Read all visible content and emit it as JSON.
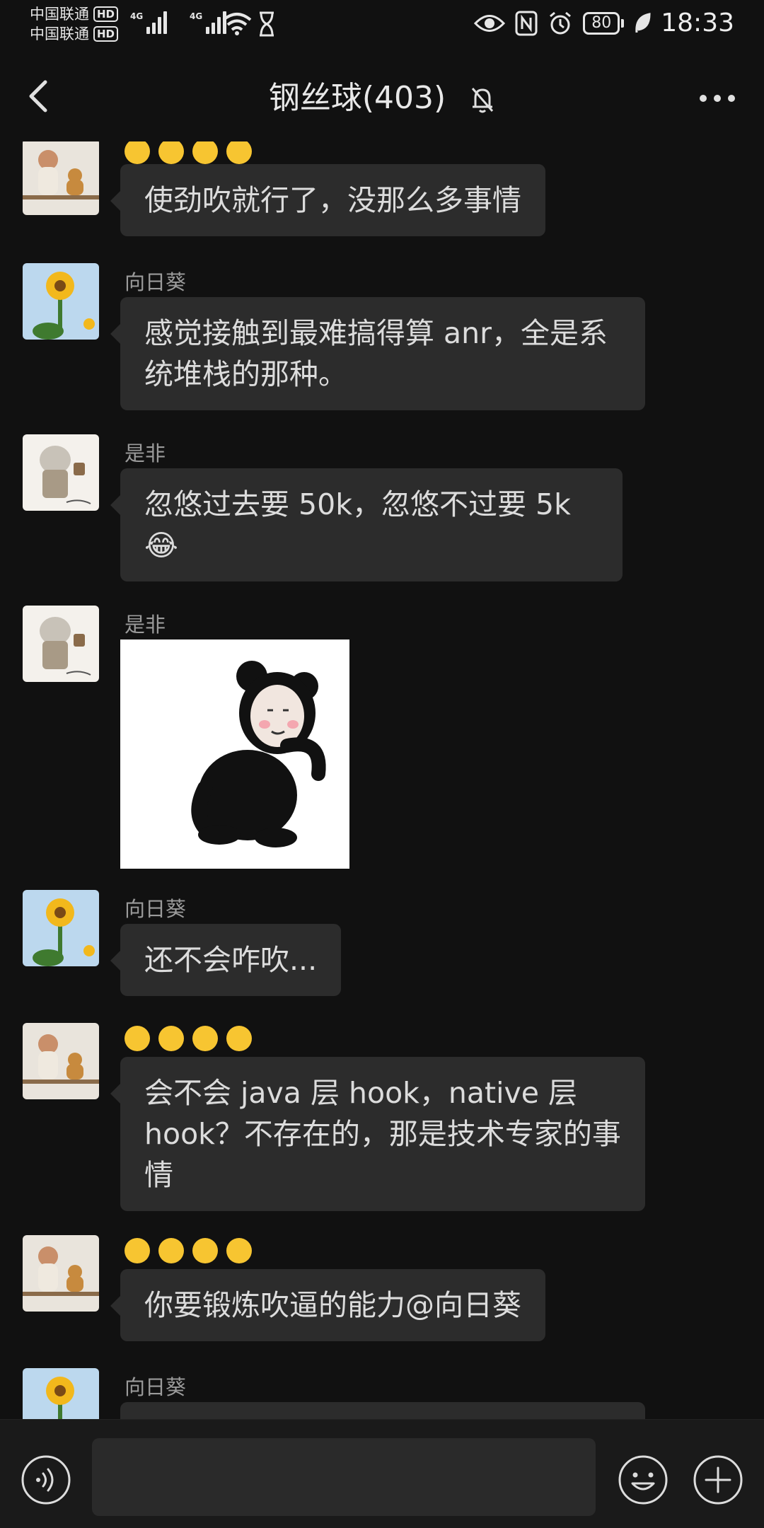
{
  "status_bar": {
    "carrier_1": "中国联通",
    "carrier_2": "中国联通",
    "hd_badge": "HD",
    "network_1": "4G",
    "network_2": "4G",
    "battery": "80",
    "time": "18:33"
  },
  "header": {
    "title": "钢丝球(403)"
  },
  "messages": [
    {
      "type": "text",
      "sender_label": "😂 😁 😃 😁",
      "text": "使劲吹就行了，没那么多事情",
      "avatar": "baby-bear-avatar"
    },
    {
      "type": "text",
      "sender_label": "向日葵",
      "text": "感觉接触到最难搞得算 anr，全是系统堆栈的那种。",
      "avatar": "sunflower-avatar"
    },
    {
      "type": "text",
      "sender_label": "是非",
      "text": "忽悠过去要 50k，忽悠不过要 5k 😂",
      "avatar": "robot-avatar"
    },
    {
      "type": "image",
      "sender_label": "是非",
      "image": "panda-sticker",
      "avatar": "robot-avatar"
    },
    {
      "type": "text",
      "sender_label": "向日葵",
      "text": "还不会咋吹...",
      "avatar": "sunflower-avatar"
    },
    {
      "type": "text",
      "sender_label": "😂 😁 😃 😁",
      "text": "会不会 java 层 hook，native 层 hook？不存在的，那是技术专家的事情",
      "avatar": "baby-bear-avatar"
    },
    {
      "type": "text",
      "sender_label": "😂 😁 😃 😁",
      "text": "你要锻炼吹逼的能力@向日葵",
      "avatar": "baby-bear-avatar"
    },
    {
      "type": "text",
      "sender_label": "向日葵",
      "text": "",
      "avatar": "sunflower-avatar"
    }
  ],
  "colors": {
    "background": "#111111",
    "bubble": "#2c2c2c",
    "input_bar": "#1a1a1a"
  }
}
